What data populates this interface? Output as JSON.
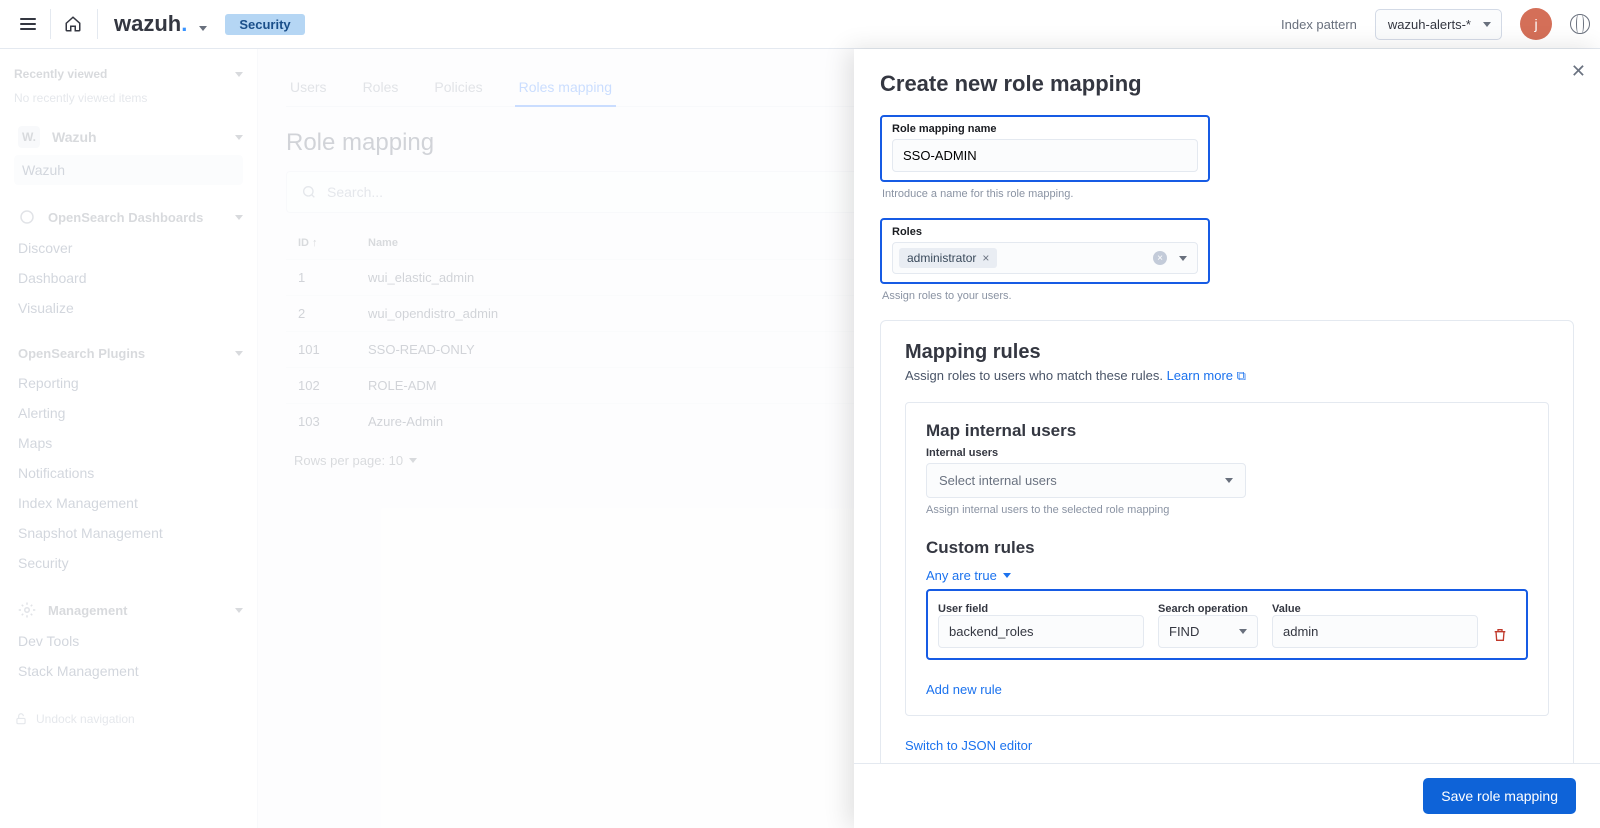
{
  "header": {
    "brand": "wazuh",
    "context": "Security",
    "index_pattern_label": "Index pattern",
    "index_pattern_value": "wazuh-alerts-*",
    "avatar_initial": "j"
  },
  "sidebar": {
    "recent_label": "Recently viewed",
    "recent_empty": "No recently viewed items",
    "wazuh_label": "Wazuh",
    "wazuh_group": [
      "Wazuh"
    ],
    "osd_label": "OpenSearch Dashboards",
    "osd_items": [
      "Discover",
      "Dashboard",
      "Visualize"
    ],
    "plugins_label": "OpenSearch Plugins",
    "plugins_items": [
      "Reporting",
      "Alerting",
      "Maps",
      "Notifications",
      "Index Management",
      "Snapshot Management",
      "Security"
    ],
    "mgmt_label": "Management",
    "mgmt_items": [
      "Dev Tools",
      "Stack Management"
    ],
    "undock": "Undock navigation"
  },
  "main": {
    "tabs": [
      "Users",
      "Roles",
      "Policies",
      "Roles mapping"
    ],
    "active_tab": "Roles mapping",
    "title": "Role mapping",
    "search_placeholder": "Search...",
    "columns": {
      "id": "ID",
      "name": "Name"
    },
    "rows": [
      {
        "id": "1",
        "name": "wui_elastic_admin"
      },
      {
        "id": "2",
        "name": "wui_opendistro_admin"
      },
      {
        "id": "101",
        "name": "SSO-READ-ONLY"
      },
      {
        "id": "102",
        "name": "ROLE-ADM"
      },
      {
        "id": "103",
        "name": "Azure-Admin"
      }
    ],
    "rpp": "Rows per page: 10"
  },
  "flyout": {
    "title": "Create new role mapping",
    "name_label": "Role mapping name",
    "name_value": "SSO-ADMIN",
    "name_help": "Introduce a name for this role mapping.",
    "roles_label": "Roles",
    "roles_selected": "administrator",
    "roles_help": "Assign roles to your users.",
    "rules_title": "Mapping rules",
    "rules_sub_prefix": "Assign roles to users who match these rules. ",
    "rules_learn": "Learn more",
    "map_internal_title": "Map internal users",
    "internal_label": "Internal users",
    "internal_placeholder": "Select internal users",
    "internal_help": "Assign internal users to the selected role mapping",
    "custom_title": "Custom rules",
    "any_true": "Any are true",
    "rule_labels": {
      "user": "User field",
      "op": "Search operation",
      "value": "Value"
    },
    "rule": {
      "user": "backend_roles",
      "op": "FIND",
      "value": "admin"
    },
    "add_rule": "Add new rule",
    "switch_json": "Switch to JSON editor",
    "save": "Save role mapping"
  }
}
